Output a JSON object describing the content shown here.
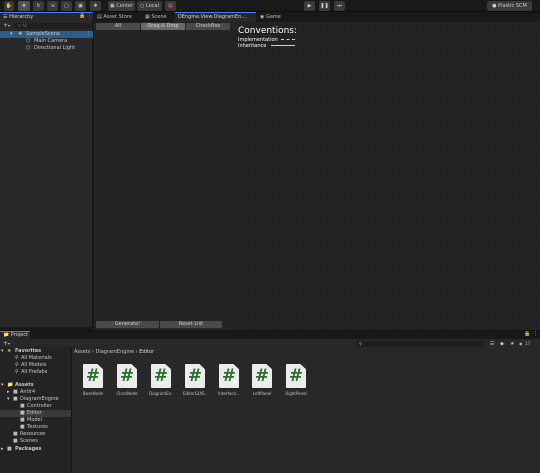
{
  "toolbar": {
    "pivot_label": "Center",
    "space_label": "Local",
    "plastic_label": "Plastic SCM"
  },
  "hierarchy": {
    "tab_label": "Hierarchy",
    "search_placeholder": "All",
    "scene_name": "SampleScene",
    "items": [
      "Main Camera",
      "Directional Light"
    ]
  },
  "tabs": [
    "Asset Store",
    "Scene",
    "DEngine.View.DiagramEn...",
    "Game"
  ],
  "left_panel": {
    "tabs": [
      "All",
      "Drag & Drop",
      "CheckBox"
    ],
    "generate_label": "Generate!",
    "reset_label": "Reset List"
  },
  "canvas": {
    "title": "Conventions:",
    "lines": [
      "Implementation",
      "Inheritance"
    ]
  },
  "project": {
    "tab_label": "Project",
    "breadcrumb": [
      "Assets",
      "DiagramEngine",
      "Editor"
    ],
    "hidden_count": "17",
    "favorites_label": "Favorites",
    "favorites": [
      "All Materials",
      "All Models",
      "All Prefabs"
    ],
    "assets_label": "Assets",
    "tree": [
      "Antlr4",
      "DiagramEngine",
      "Controller",
      "Editor",
      "Model",
      "Textures",
      "Resources",
      "Scenes"
    ],
    "packages_label": "Packages",
    "files": [
      {
        "name": "BaseNode",
        "glyph": "#"
      },
      {
        "name": "ClassNode",
        "glyph": "#"
      },
      {
        "name": "DiagramEn...",
        "glyph": "#"
      },
      {
        "name": "EditorGUIS...",
        "glyph": "#"
      },
      {
        "name": "Interface...",
        "glyph": "#"
      },
      {
        "name": "LeftPanel",
        "glyph": "#"
      },
      {
        "name": "RightPanel",
        "glyph": "#"
      }
    ]
  },
  "colors": {
    "accent": "#4c7efb",
    "selection": "#2c5d87",
    "script_icon_glyph": "#2f6d2f"
  }
}
